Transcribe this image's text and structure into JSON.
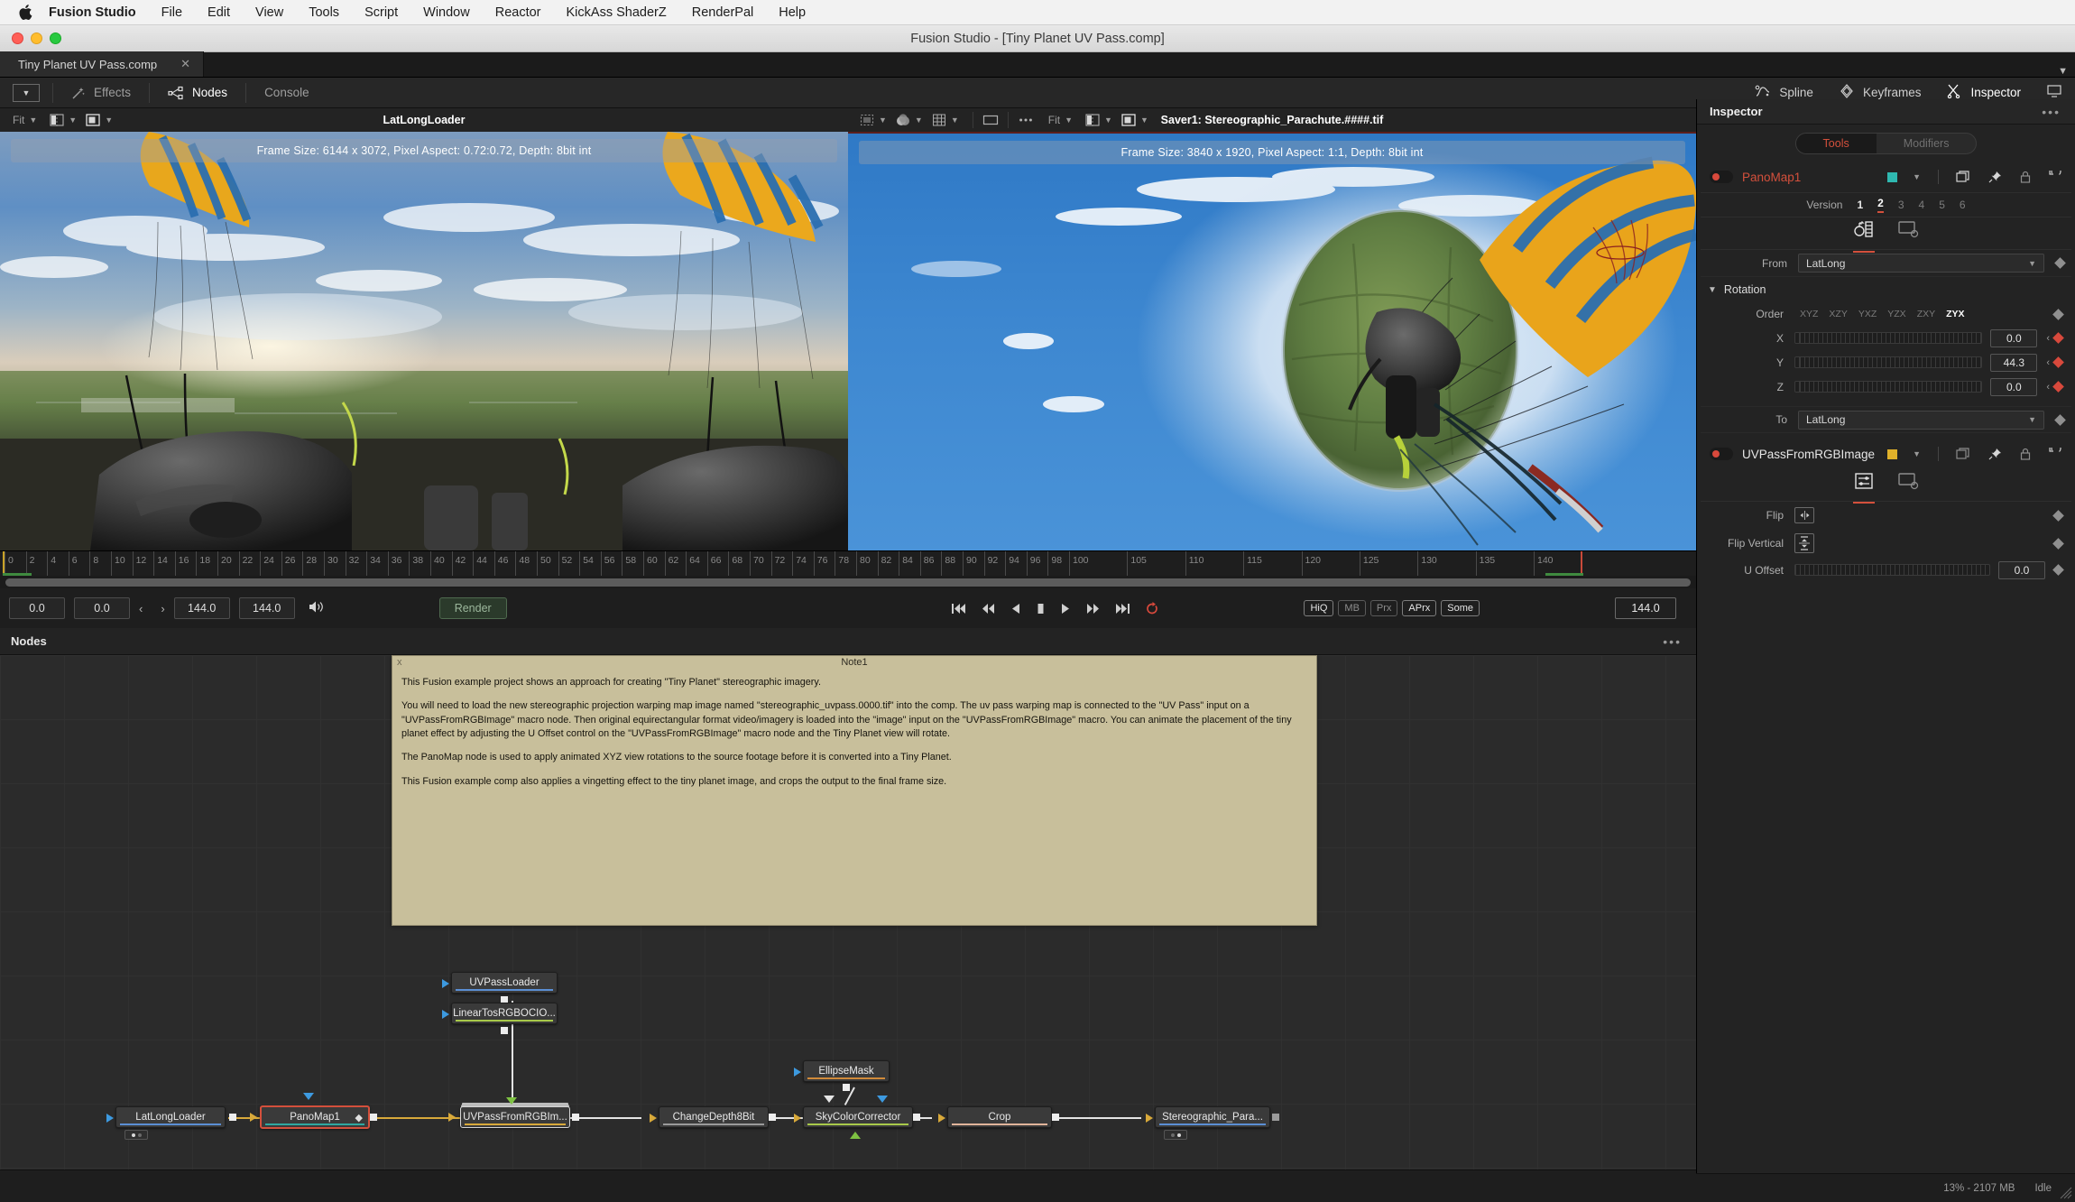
{
  "macmenu": {
    "app": "Fusion Studio",
    "items": [
      "File",
      "Edit",
      "View",
      "Tools",
      "Script",
      "Window",
      "Reactor",
      "KickAss ShaderZ",
      "RenderPal",
      "Help"
    ]
  },
  "window": {
    "title": "Fusion Studio - [Tiny Planet UV Pass.comp]"
  },
  "comptab": {
    "label": "Tiny Planet UV Pass.comp",
    "close": "✕"
  },
  "toolbar": {
    "effects": "Effects",
    "nodes": "Nodes",
    "console": "Console",
    "spline": "Spline",
    "keyframes": "Keyframes",
    "inspector": "Inspector"
  },
  "viewers": [
    {
      "name": "viewer-left",
      "fit": "Fit",
      "title": "LatLongLoader",
      "frame_info": "Frame Size: 6144 x 3072, Pixel Aspect: 0.72:0.72, Depth: 8bit int"
    },
    {
      "name": "viewer-right",
      "fit": "Fit",
      "title": "Saver1: Stereographic_Parachute.####.tif",
      "frame_info": "Frame Size: 3840 x 1920, Pixel Aspect: 1:1, Depth: 8bit int"
    }
  ],
  "timeline": {
    "ticks_2step": [
      0,
      2,
      4,
      6,
      8,
      10,
      12,
      14,
      16,
      18,
      20,
      22,
      24,
      26,
      28,
      30,
      32,
      34,
      36,
      38,
      40,
      42,
      44,
      46,
      48,
      50,
      52,
      54,
      56,
      58,
      60,
      62,
      64,
      66,
      68,
      70,
      72,
      74,
      76,
      78,
      80,
      82,
      84,
      86,
      88,
      90,
      92,
      94,
      96,
      98,
      100
    ],
    "ticks_5step": [
      105,
      110,
      115,
      120,
      125,
      130,
      135,
      140
    ],
    "start": "0.0",
    "global_start": "0.0",
    "end": "144.0",
    "global_end": "144.0",
    "current_frame": "144.0",
    "render_label": "Render",
    "quality": [
      {
        "label": "HiQ",
        "on": true
      },
      {
        "label": "MB",
        "on": false
      },
      {
        "label": "Prx",
        "on": false
      },
      {
        "label": "APrx",
        "on": true
      },
      {
        "label": "Some",
        "on": true
      }
    ]
  },
  "nodes_panel": {
    "title": "Nodes"
  },
  "note": {
    "title": "Note1",
    "close": "x",
    "paragraphs": [
      "This Fusion example project shows an approach for creating \"Tiny Planet\" stereographic imagery.",
      "You will need to load the new stereographic projection warping map image named \"stereographic_uvpass.0000.tif\" into the comp. The uv pass warping map is connected to the \"UV Pass\" input on a \"UVPassFromRGBImage\" macro node. Then original equirectangular format video/imagery is loaded into the \"image\" input on the \"UVPassFromRGBImage\" macro. You can animate the placement of the tiny planet effect by adjusting the U Offset control on the \"UVPassFromRGBImage\" macro node and the Tiny Planet view will rotate.",
      "The PanoMap node is used to apply animated XYZ view rotations to the source footage before it is converted into a Tiny Planet.",
      "This Fusion example comp also applies a vingetting effect to the tiny planet image, and crops the output to the final frame size."
    ]
  },
  "graph": {
    "nodes": [
      {
        "id": "uvpassloader",
        "label": "UVPassLoader",
        "bar": "#5b8fd4"
      },
      {
        "id": "lineartosrgbocio",
        "label": "LinearTosRGBOCIO...",
        "bar": "#a8c94a"
      },
      {
        "id": "latlongloader",
        "label": "LatLongLoader",
        "bar": "#5b8fd4"
      },
      {
        "id": "panomap1",
        "label": "PanoMap1",
        "bar": "#2fa8a0"
      },
      {
        "id": "uvpassfromrgbimage",
        "label": "UVPassFromRGBIm...",
        "bar": "#d8a93a"
      },
      {
        "id": "changedepth8bit",
        "label": "ChangeDepth8Bit",
        "bar": "#9a9a9a"
      },
      {
        "id": "ellipsemask",
        "label": "EllipseMask",
        "bar": "#d08a3a"
      },
      {
        "id": "skycolorcorrector",
        "label": "SkyColorCorrector",
        "bar": "#a8c94a"
      },
      {
        "id": "crop",
        "label": "Crop",
        "bar": "#e0b49a"
      },
      {
        "id": "stereographic_para",
        "label": "Stereographic_Para...",
        "bar": "#5b8fd4"
      }
    ]
  },
  "inspector": {
    "title": "Inspector",
    "tabs": [
      {
        "label": "Tools",
        "on": true
      },
      {
        "label": "Modifiers",
        "on": false
      }
    ],
    "tools": [
      {
        "name": "PanoMap1",
        "color": "#2fb8b0",
        "version_label": "Version",
        "versions": [
          "1",
          "2",
          "3",
          "4",
          "5",
          "6"
        ],
        "active_version": "2",
        "params": {
          "from_label": "From",
          "from_value": "LatLong",
          "rotation_label": "Rotation",
          "order_label": "Order",
          "order_options": [
            "XYZ",
            "XZY",
            "YXZ",
            "YZX",
            "ZXY",
            "ZYX"
          ],
          "order_active": "ZYX",
          "x_label": "X",
          "x_value": "0.0",
          "y_label": "Y",
          "y_value": "44.3",
          "z_label": "Z",
          "z_value": "0.0",
          "to_label": "To",
          "to_value": "LatLong"
        }
      },
      {
        "name": "UVPassFromRGBImage",
        "color": "#e0b12a",
        "params": {
          "flip_label": "Flip",
          "flip_vertical_label": "Flip Vertical",
          "u_offset_label": "U Offset",
          "u_offset_value": "0.0"
        }
      }
    ]
  },
  "status": {
    "memory": "13% - 2107 MB",
    "state": "Idle"
  }
}
